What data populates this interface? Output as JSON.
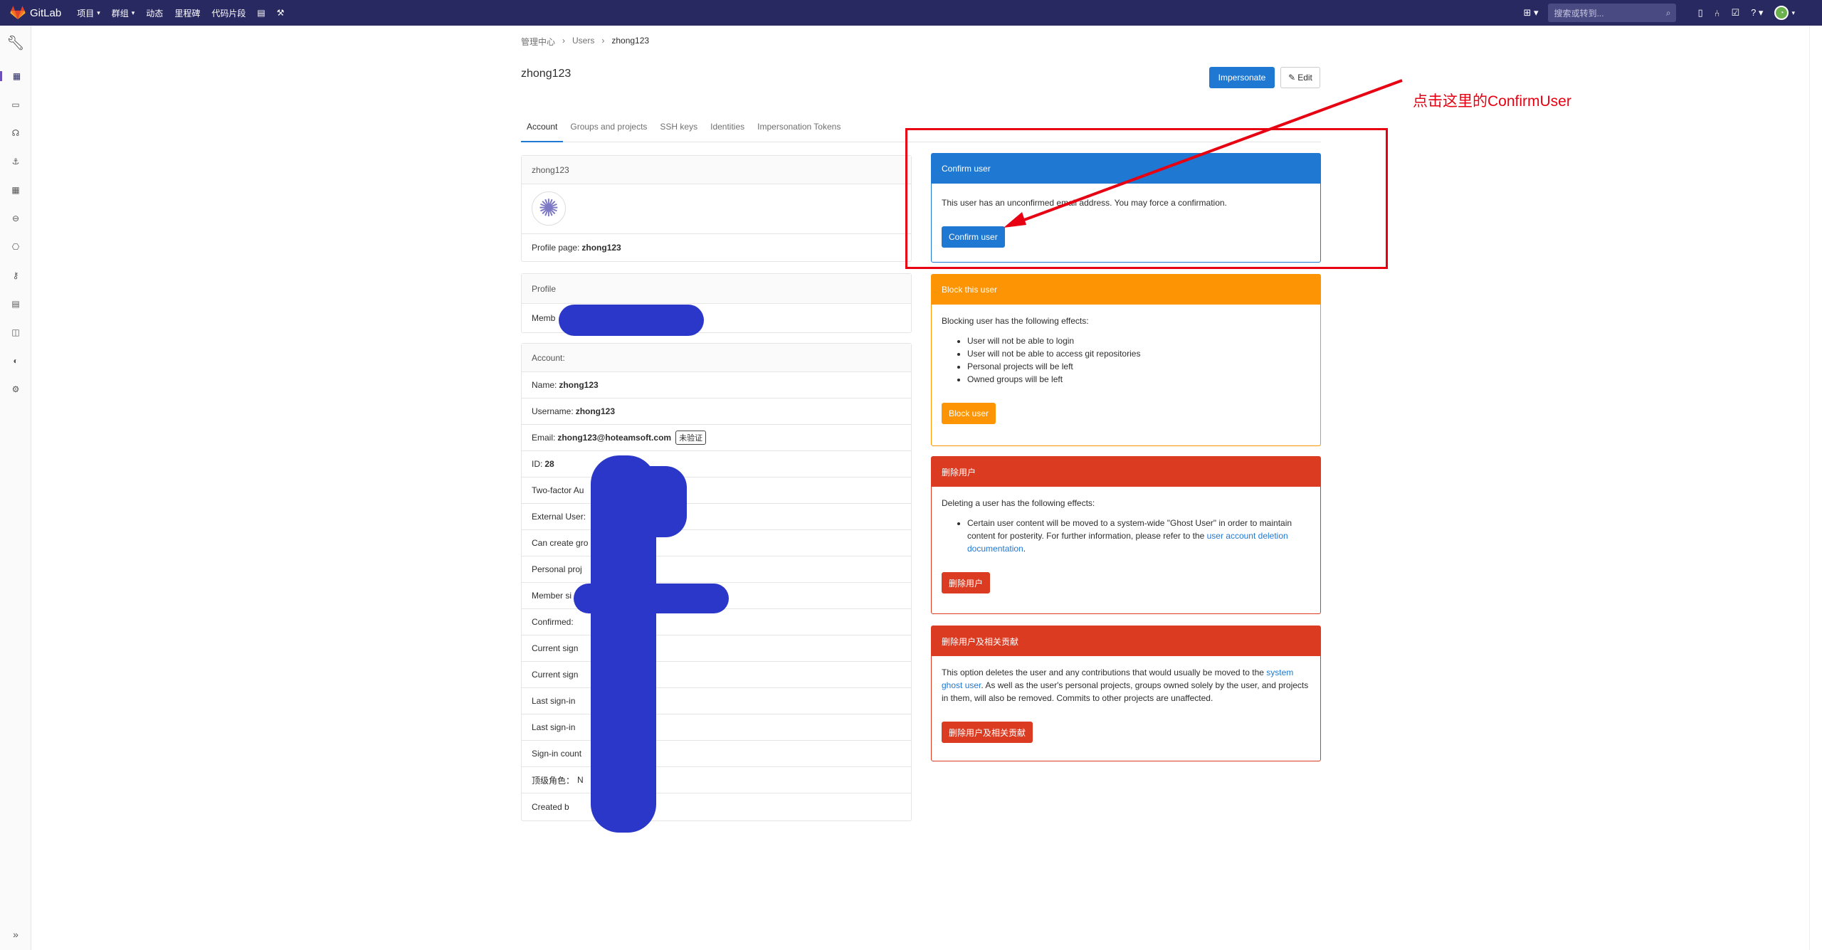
{
  "topbar": {
    "brand": "GitLab",
    "nav": [
      "项目",
      "群组",
      "动态",
      "里程碑",
      "代码片段"
    ],
    "search_placeholder": "搜索或转到..."
  },
  "breadcrumb": [
    "管理中心",
    "Users",
    "zhong123"
  ],
  "page": {
    "title": "zhong123",
    "impersonate_label": "Impersonate",
    "edit_label": "Edit"
  },
  "tabs": [
    "Account",
    "Groups and projects",
    "SSH keys",
    "Identities",
    "Impersonation Tokens"
  ],
  "profile_card": {
    "header": "zhong123",
    "profile_label": "Profile page:",
    "profile_value": "zhong123"
  },
  "profile_panel": {
    "header": "Profile",
    "member_label": "Memb"
  },
  "account_panel": {
    "header": "Account:",
    "rows": [
      {
        "label": "Name:",
        "value": "zhong123"
      },
      {
        "label": "Username:",
        "value": "zhong123"
      },
      {
        "label": "Email:",
        "value": "zhong123@hoteamsoft.com",
        "badge": "未验证"
      },
      {
        "label": "ID:",
        "value": "28"
      },
      {
        "label": "Two-factor Au",
        "value": ""
      },
      {
        "label": "External User:",
        "value": ""
      },
      {
        "label": "Can create gro",
        "value": ""
      },
      {
        "label": "Personal proj",
        "value": ""
      },
      {
        "label": "Member si",
        "value": ""
      },
      {
        "label": "Confirmed:",
        "value": ""
      },
      {
        "label": "Current sign",
        "value": ""
      },
      {
        "label": "Current sign",
        "value": ""
      },
      {
        "label": "Last sign-in",
        "value": ""
      },
      {
        "label": "Last sign-in",
        "value": ""
      },
      {
        "label": "Sign-in count",
        "value": ""
      },
      {
        "label": "顶级角色：",
        "value": "N"
      },
      {
        "label": "Created b",
        "value": ""
      }
    ]
  },
  "confirm_card": {
    "header": "Confirm user",
    "text": "This user has an unconfirmed email address. You may force a confirmation.",
    "button": "Confirm user"
  },
  "block_card": {
    "header": "Block this user",
    "intro": "Blocking user has the following effects:",
    "items": [
      "User will not be able to login",
      "User will not be able to access git repositories",
      "Personal projects will be left",
      "Owned groups will be left"
    ],
    "button": "Block user"
  },
  "delete_card": {
    "header": "删除用户",
    "intro": "Deleting a user has the following effects:",
    "item_text": "Certain user content will be moved to a system-wide \"Ghost User\" in order to maintain content for posterity. For further information, please refer to the ",
    "item_link": "user account deletion documentation",
    "item_end": ".",
    "button": "删除用户"
  },
  "delete_contrib_card": {
    "header": "删除用户及相关贡献",
    "text_a": "This option deletes the user and any contributions that would usually be moved to the ",
    "link": "system ghost user",
    "text_b": ". As well as the user's personal projects, groups owned solely by the user, and projects in them, will also be removed. Commits to other projects are unaffected.",
    "button": "删除用户及相关贡献"
  },
  "annotation": {
    "text": "点击这里的ConfirmUser",
    "color": "#e60012"
  },
  "colors": {
    "nav": "#292961",
    "primary": "#1f78d1",
    "warning": "#fc9403",
    "danger": "#db3b21",
    "redaction": "#2a37c9"
  }
}
